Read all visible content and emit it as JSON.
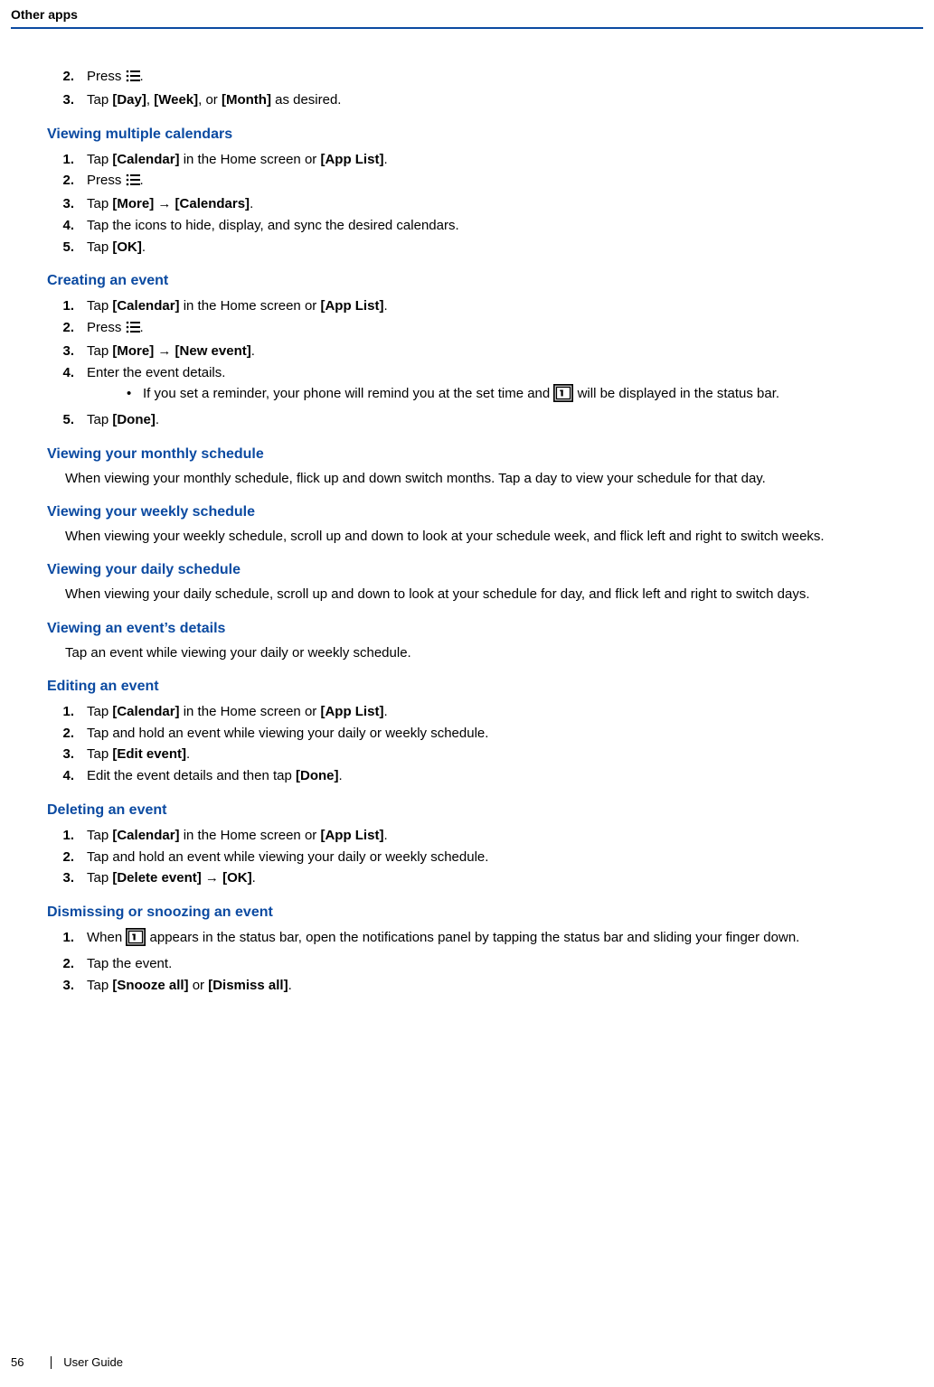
{
  "header": {
    "title": "Other apps"
  },
  "footer": {
    "page": "56",
    "label": "User Guide"
  },
  "icons": {
    "menu": "menu-icon",
    "calendar": "calendar-icon"
  },
  "arrow": "→",
  "top_steps": [
    {
      "n": "2.",
      "pre": "Press ",
      "icon": "menu",
      "post": "."
    },
    {
      "n": "3.",
      "html": "Tap <b>[Day]</b>, <b>[Week]</b>, or <b>[Month]</b> as desired."
    }
  ],
  "sections": [
    {
      "heading": "Viewing multiple calendars",
      "steps": [
        {
          "n": "1.",
          "html": "Tap <b>[Calendar]</b> in the Home screen or <b>[App List]</b>."
        },
        {
          "n": "2.",
          "pre": "Press ",
          "icon": "menu",
          "post": "."
        },
        {
          "n": "3.",
          "html": "Tap <b>[More]</b> {arrow} <b>[Calendars]</b>."
        },
        {
          "n": "4.",
          "html": "Tap the icons to hide, display, and sync the desired calendars."
        },
        {
          "n": "5.",
          "html": "Tap <b>[OK]</b>."
        }
      ]
    },
    {
      "heading": "Creating an event",
      "steps": [
        {
          "n": "1.",
          "html": "Tap <b>[Calendar]</b> in the Home screen or <b>[App List]</b>."
        },
        {
          "n": "2.",
          "pre": "Press ",
          "icon": "menu",
          "post": "."
        },
        {
          "n": "3.",
          "html": "Tap <b>[More]</b> {arrow} <b>[New event]</b>."
        },
        {
          "n": "4.",
          "html": "Enter the event details.",
          "sub": [
            {
              "pre": "If you set a reminder, your phone will remind you at the set time and ",
              "icon": "cal",
              "post": " will be displayed in the status bar."
            }
          ]
        },
        {
          "n": "5.",
          "html": "Tap <b>[Done]</b>."
        }
      ]
    },
    {
      "heading": "Viewing your monthly schedule",
      "para": "When viewing your monthly schedule, flick up and down switch months. Tap a day to view your schedule for that day."
    },
    {
      "heading": "Viewing your weekly schedule",
      "para": "When viewing your weekly schedule, scroll up and down to look at your schedule week, and flick left and right to switch weeks."
    },
    {
      "heading": "Viewing your daily schedule",
      "para": "When viewing your daily schedule, scroll up and down to look at your schedule for day, and flick left and right to switch days."
    },
    {
      "heading": "Viewing an event’s details",
      "para": "Tap an event while viewing your daily or weekly schedule."
    },
    {
      "heading": "Editing an event",
      "steps": [
        {
          "n": "1.",
          "html": "Tap <b>[Calendar]</b> in the Home screen or <b>[App List]</b>."
        },
        {
          "n": "2.",
          "html": "Tap and hold an event while viewing your daily or weekly schedule."
        },
        {
          "n": "3.",
          "html": "Tap <b>[Edit event]</b>."
        },
        {
          "n": "4.",
          "html": "Edit the event details and then tap <b>[Done]</b>."
        }
      ]
    },
    {
      "heading": "Deleting an event",
      "steps": [
        {
          "n": "1.",
          "html": "Tap <b>[Calendar]</b> in the Home screen or <b>[App List]</b>."
        },
        {
          "n": "2.",
          "html": "Tap and hold an event while viewing your daily or weekly schedule."
        },
        {
          "n": "3.",
          "html": "Tap <b>[Delete event]</b> {arrow} <b>[OK]</b>."
        }
      ]
    },
    {
      "heading": "Dismissing or snoozing an event",
      "steps": [
        {
          "n": "1.",
          "pre": "When ",
          "icon": "cal",
          "post": " appears in the status bar, open the notifications panel by tapping the status bar and sliding your finger down."
        },
        {
          "n": "2.",
          "html": "Tap the event."
        },
        {
          "n": "3.",
          "html": "Tap <b>[Snooze all]</b> or <b>[Dismiss all]</b>."
        }
      ]
    }
  ]
}
